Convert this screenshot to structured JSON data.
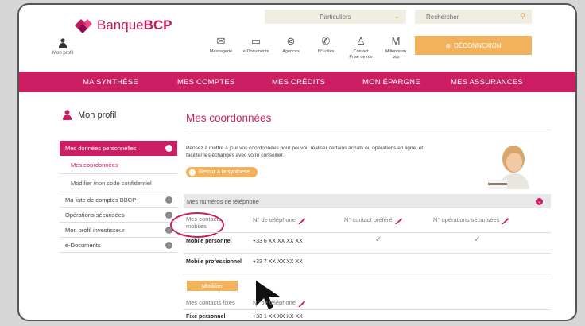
{
  "brand": {
    "name_prefix": "Banque",
    "name_bold": "BCP",
    "accent": "#cc1f63",
    "secondary": "#f2b25c"
  },
  "header": {
    "profile_label": "Mon profil",
    "segment": "Particuliers",
    "search_placeholder": "Rechercher",
    "tools": [
      {
        "label": "Messagerie",
        "icon": "envelope-icon"
      },
      {
        "label": "e-Documents",
        "icon": "folder-icon"
      },
      {
        "label": "Agences",
        "icon": "map-pin-icon"
      },
      {
        "label": "N° utiles",
        "icon": "phone-icon"
      },
      {
        "label": "Contact\nPrise de rdv",
        "icon": "contact-icon"
      },
      {
        "label": "Millennium\nbcp",
        "icon": "millennium-icon"
      }
    ],
    "millennium_letter": "M",
    "logout": "DÉCONNEXION"
  },
  "nav": [
    "MA SYNTHÈSE",
    "MES COMPTES",
    "MES CRÉDITS",
    "MON ÉPARGNE",
    "MES ASSURANCES"
  ],
  "sidebar": {
    "title": "Mon profil",
    "active": "Mes données personnelles",
    "sub": [
      "Mes coordonnées",
      "Modifier mon code confidentiel"
    ],
    "items": [
      "Ma liste de comptes BBCP",
      "Opérations sécurisées",
      "Mon profil investisseur",
      "e-Documents"
    ]
  },
  "main": {
    "title": "Mes coordonnées",
    "intro": "Pensez à mettre à jour vos coordonnées pour pouvoir réaliser certains achats ou opérations en ligne, et faciliter les échanges avec votre conseiller.",
    "back": "Retour à la synthèse",
    "section": "Mes numéros de téléphone",
    "mobile_header": "Mes contacts mobiles",
    "col_phone": "N° de téléphone",
    "col_pref": "N° contact préféré",
    "col_sec": "N° opérations sécurisées",
    "rows": [
      {
        "label": "Mobile personnel",
        "number": "+33 6 XX XX XX XX",
        "preferred": "✓",
        "secure": "✓"
      },
      {
        "label": "Mobile professionnel",
        "number": "+33 7 XX XX XX XX",
        "preferred": "",
        "secure": ""
      }
    ],
    "modify": "Modifier",
    "fixed_header": "Mes contacts fixes",
    "fixed_rows": [
      {
        "label": "Fixe personnel",
        "number": "+33 1 XX XX XX XX"
      }
    ]
  }
}
